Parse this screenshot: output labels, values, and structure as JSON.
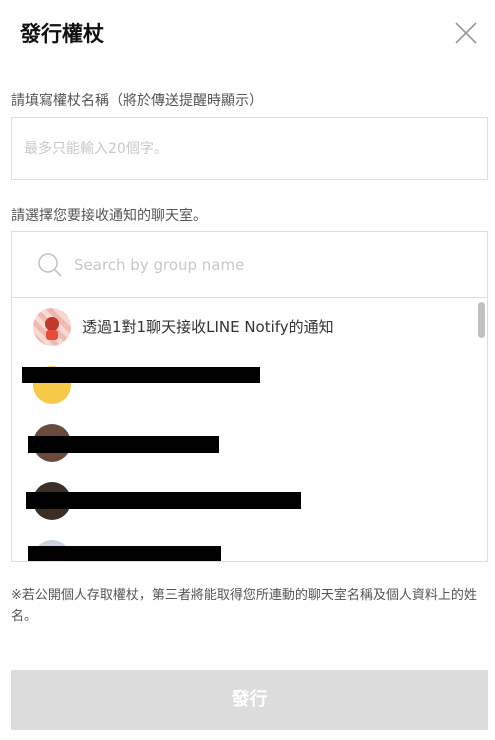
{
  "dialog": {
    "title": "發行權杖"
  },
  "token_name": {
    "label": "請填寫權杖名稱（將於傳送提醒時顯示）",
    "placeholder": "最多只能輸入20個字。",
    "value": ""
  },
  "chat_room": {
    "label": "請選擇您要接收通知的聊天室。",
    "search_placeholder": "Search by group name",
    "items": [
      {
        "label": "透過1對1聊天接收LINE Notify的通知",
        "avatar_color": "#f4c9c2"
      },
      {
        "label": "",
        "avatar_color": "#f7c948"
      },
      {
        "label": "",
        "avatar_color": "#6b4a3e"
      },
      {
        "label": "",
        "avatar_color": "#3b2e24"
      },
      {
        "label": "",
        "avatar_color": "#c9d3df"
      }
    ]
  },
  "note": "※若公開個人存取權杖，第三者將能取得您所連動的聊天室名稱及個人資料上的姓名。",
  "issue_button": {
    "label": "發行",
    "background": "#dcdcdc"
  },
  "icons": [
    "close-icon",
    "search-icon",
    "scrollbar"
  ]
}
